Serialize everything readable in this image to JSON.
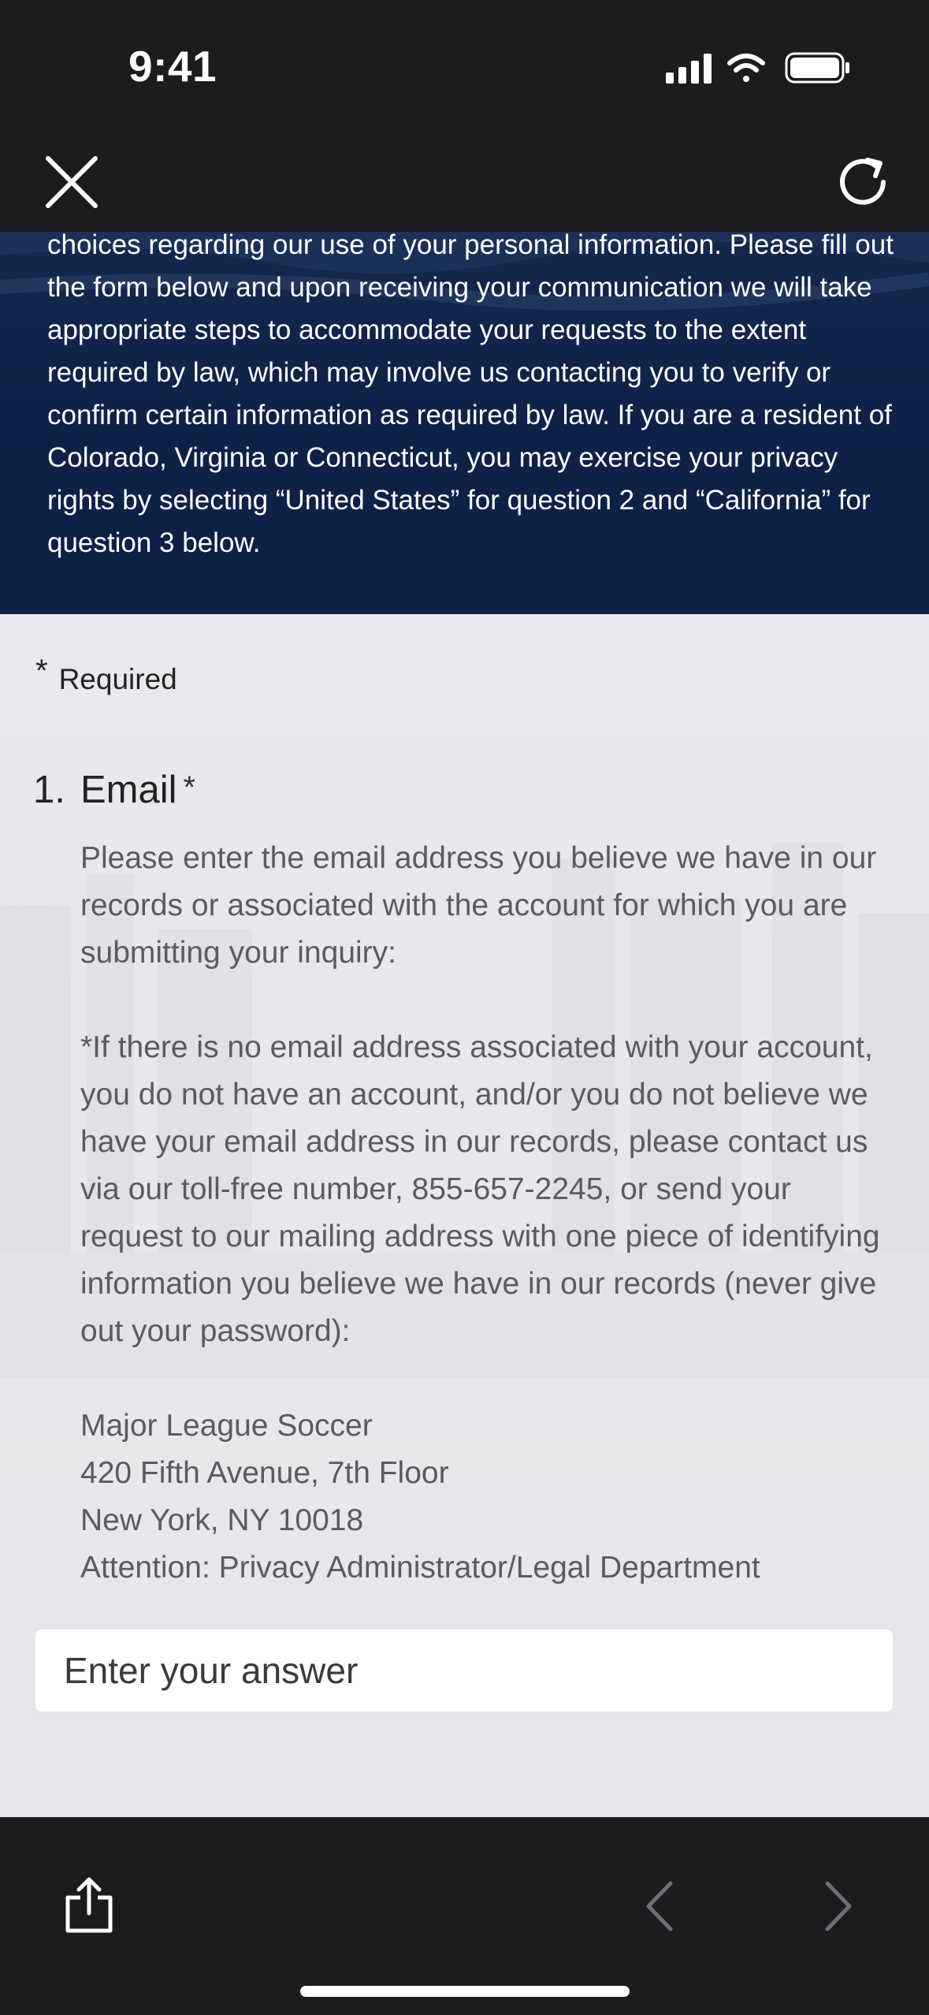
{
  "status_bar": {
    "time": "9:41",
    "icons": [
      "cellular-signal-icon",
      "wifi-icon",
      "battery-icon"
    ]
  },
  "browser": {
    "close_icon": "close-icon",
    "reload_icon": "reload-icon"
  },
  "intro": {
    "text": "choices regarding our use of your personal information. Please fill out the form below and upon receiving your communication we will take appropriate steps to accommodate your requests to the extent required by law, which may involve us contacting you to verify or confirm certain information as required by law. If you are a resident of Colorado, Virginia or Connecticut, you may exercise your privacy rights by selecting “United States” for question 2 and “California” for question 3 below."
  },
  "form": {
    "required_asterisk": "*",
    "required_label": "Required",
    "question": {
      "number": "1.",
      "title": "Email",
      "required_mark": "*",
      "para1": "Please enter the email address you believe we have in our records or associated with the account for which you are submitting your inquiry:",
      "para2": "*If there is no email address associated with your account, you do not have an account, and/or you do not believe we have your email address in our records, please contact us via our toll-free number, 855-657-2245, or send your request to our mailing address with one piece of identifying information you believe we have in our records (never give out your password):",
      "address": [
        "Major League Soccer",
        "420 Fifth Avenue, 7th Floor",
        "New York, NY 10018",
        "Attention: Privacy Administrator/Legal Department"
      ],
      "answer_placeholder": "Enter your answer",
      "answer_value": ""
    }
  },
  "toolbar": {
    "share_icon": "share-icon",
    "back_icon": "chevron-left-icon",
    "forward_icon": "chevron-right-icon"
  },
  "colors": {
    "chrome": "#1c1c1e",
    "intro_bg": "#0f234a",
    "form_bg": "#e8e9ec",
    "body_text": "#5a5b60",
    "disabled_nav": "#6e6e73"
  }
}
